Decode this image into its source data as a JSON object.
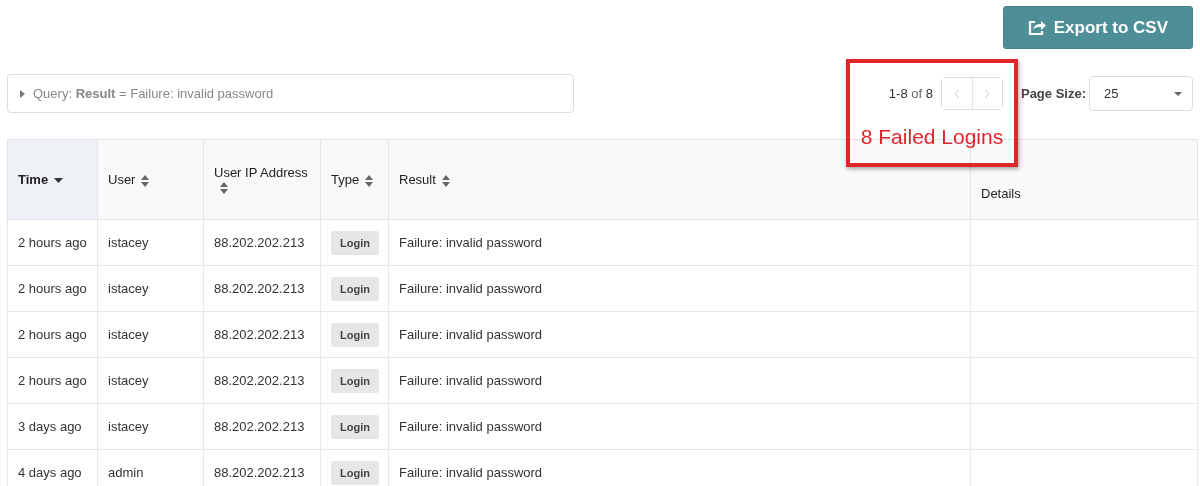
{
  "toolbar": {
    "export_button": "Export to CSV"
  },
  "query": {
    "expanded": false,
    "label": "Query:",
    "text": "**Result** = Failure: invalid password"
  },
  "pagination": {
    "range": "1-8",
    "of": "of",
    "total": "8",
    "prev_disabled": true,
    "next_disabled": true,
    "page_size_label": "Page Size:",
    "page_size": "25"
  },
  "annotation": {
    "text": "8 Failed Logins",
    "color": "#e0262b"
  },
  "table": {
    "columns": [
      {
        "label": "Time",
        "sortable": true,
        "sorted": true
      },
      {
        "label": "User",
        "sortable": true,
        "sorted": false
      },
      {
        "label": "User IP Address",
        "sortable": true,
        "sorted": false
      },
      {
        "label": "Type",
        "sortable": true,
        "sorted": false
      },
      {
        "label": "Result",
        "sortable": true,
        "sorted": false
      },
      {
        "label": "Details",
        "sortable": false,
        "sorted": false
      }
    ],
    "rows": [
      {
        "time": "2 hours ago",
        "user": "istacey",
        "ip": "88.202.202.213",
        "type": "Login",
        "result": "Failure: invalid password"
      },
      {
        "time": "2 hours ago",
        "user": "istacey",
        "ip": "88.202.202.213",
        "type": "Login",
        "result": "Failure: invalid password"
      },
      {
        "time": "2 hours ago",
        "user": "istacey",
        "ip": "88.202.202.213",
        "type": "Login",
        "result": "Failure: invalid password"
      },
      {
        "time": "2 hours ago",
        "user": "istacey",
        "ip": "88.202.202.213",
        "type": "Login",
        "result": "Failure: invalid password"
      },
      {
        "time": "3 days ago",
        "user": "istacey",
        "ip": "88.202.202.213",
        "type": "Login",
        "result": "Failure: invalid password"
      },
      {
        "time": "4 days ago",
        "user": "admin",
        "ip": "88.202.202.213",
        "type": "Login",
        "result": "Failure: invalid password"
      }
    ]
  }
}
